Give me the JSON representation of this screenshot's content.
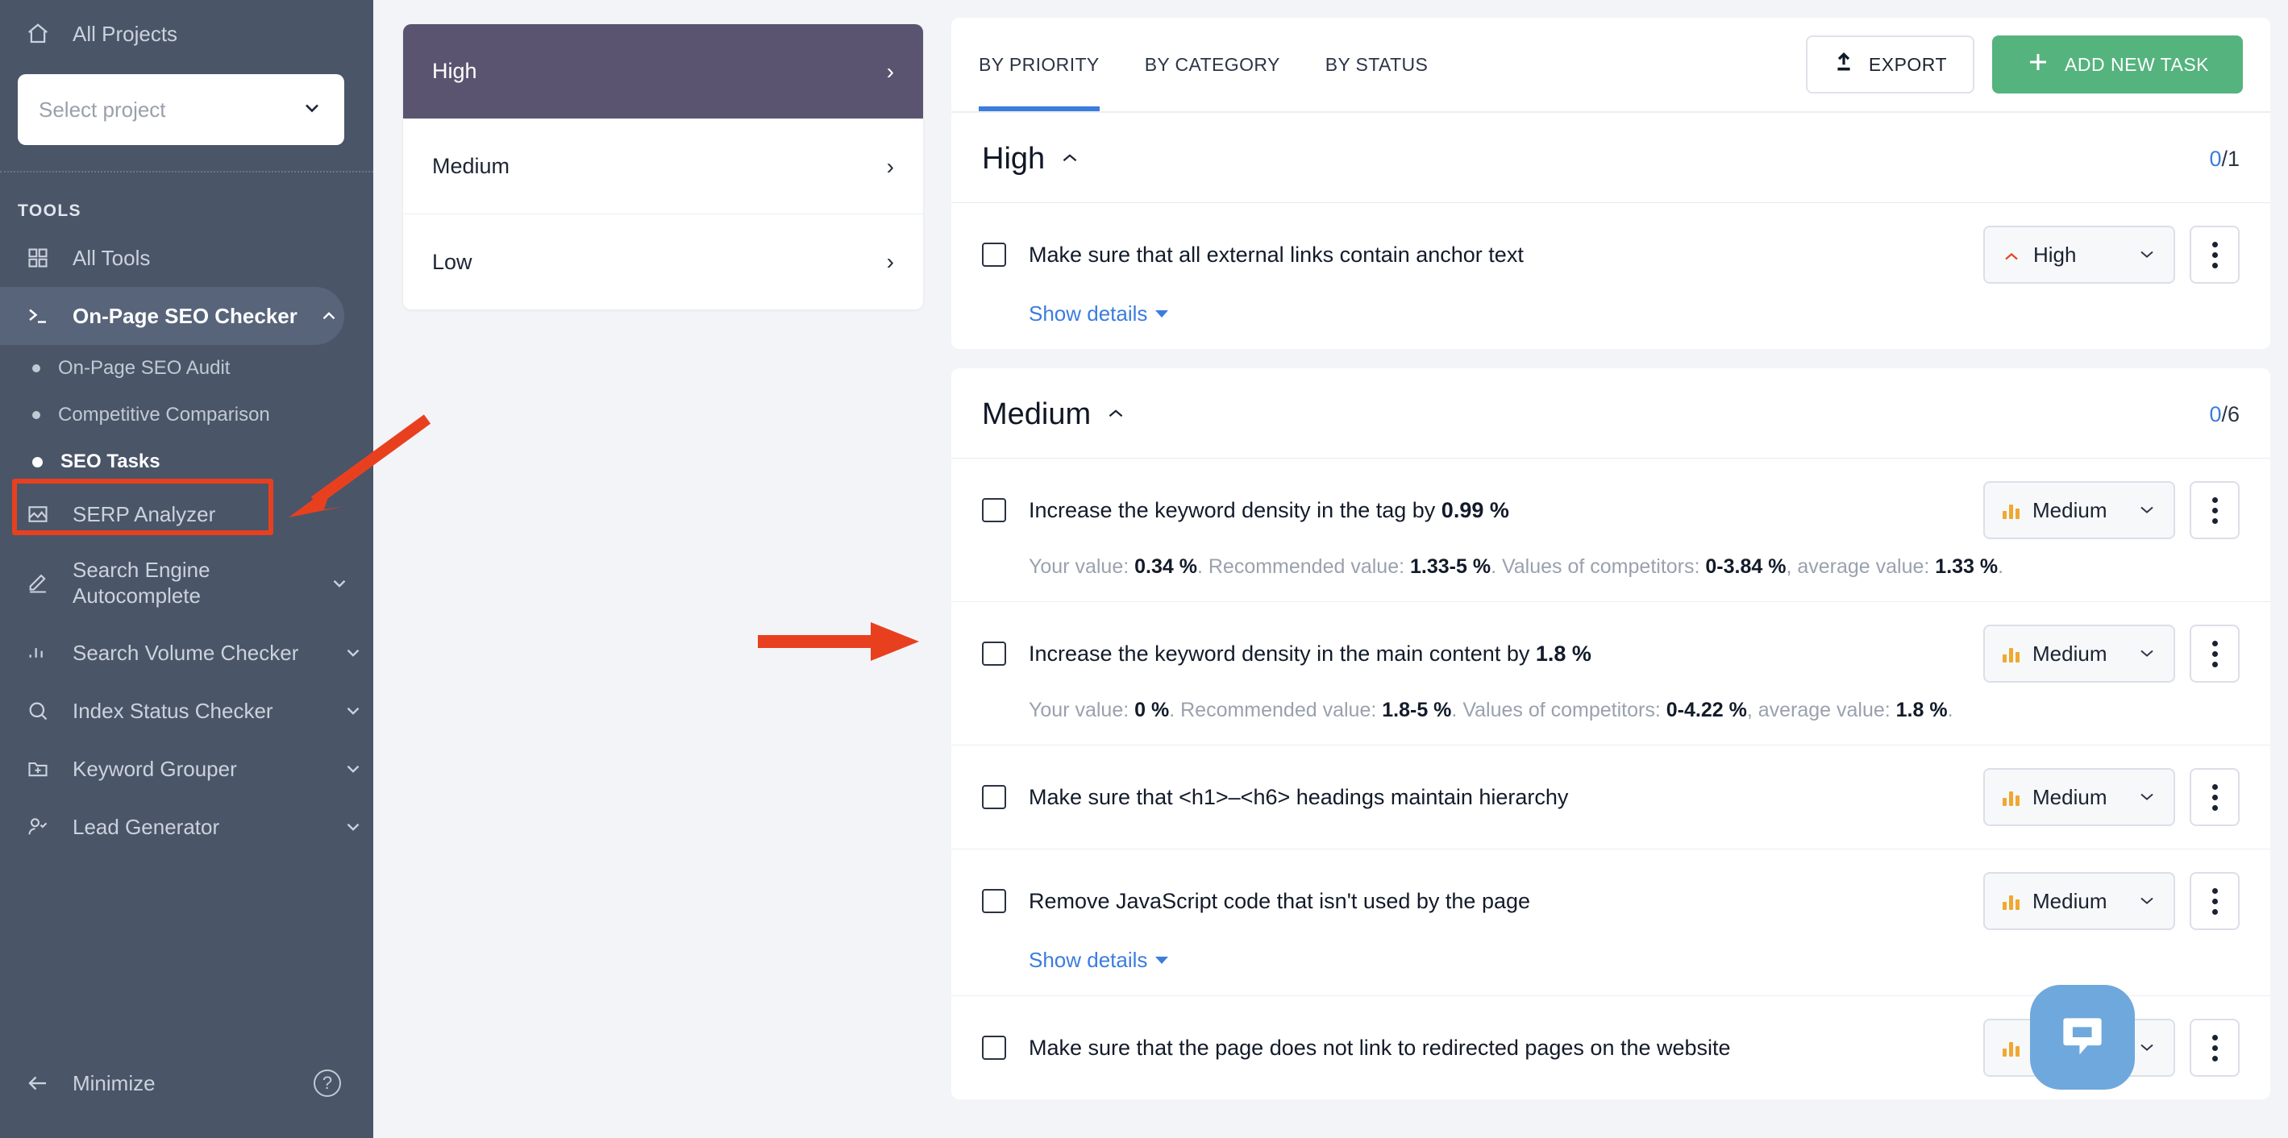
{
  "sidebar": {
    "all_projects": {
      "label": "All Projects",
      "icon": "home-icon"
    },
    "project_select": {
      "placeholder": "Select project",
      "icon": "chevron-down-icon"
    },
    "section_title": "TOOLS",
    "items": [
      {
        "label": "All Tools",
        "icon": "grid-icon",
        "caret": ""
      },
      {
        "label": "On-Page SEO Checker",
        "icon": "terminal-icon",
        "caret": "˄",
        "active": true
      },
      {
        "label": "SERP Analyzer",
        "icon": "image-chart-icon",
        "caret": ""
      },
      {
        "label": "Search Engine Autocomplete",
        "icon": "pencil-icon",
        "caret": "˅"
      },
      {
        "label": "Search Volume Checker",
        "icon": "bar-chart-icon",
        "caret": "˅"
      },
      {
        "label": "Index Status Checker",
        "icon": "search-icon",
        "caret": "˅"
      },
      {
        "label": "Keyword Grouper",
        "icon": "folder-plus-icon",
        "caret": "˅"
      },
      {
        "label": "Lead Generator",
        "icon": "user-check-icon",
        "caret": "˅"
      }
    ],
    "subitems": [
      {
        "label": "On-Page SEO Audit",
        "selected": false
      },
      {
        "label": "Competitive Comparison",
        "selected": false
      },
      {
        "label": "SEO Tasks",
        "selected": true
      }
    ],
    "minimize": {
      "label": "Minimize",
      "icon": "arrow-left-icon"
    },
    "help": "?"
  },
  "priority_panel": {
    "items": [
      {
        "label": "High",
        "chevron": "›",
        "active": true
      },
      {
        "label": "Medium",
        "chevron": "›",
        "active": false
      },
      {
        "label": "Low",
        "chevron": "›",
        "active": false
      }
    ]
  },
  "toolbar": {
    "tabs": [
      {
        "label": "BY PRIORITY",
        "active": true
      },
      {
        "label": "BY CATEGORY",
        "active": false
      },
      {
        "label": "BY STATUS",
        "active": false
      }
    ],
    "export_label": "EXPORT",
    "add_task_label": "ADD NEW TASK",
    "accent_green": "#55b37e",
    "accent_blue": "#3b7ddd"
  },
  "sections": {
    "high": {
      "title": "High",
      "caret": "˄",
      "count_done": "0",
      "count_total": "/1",
      "tasks": [
        {
          "text": "Make sure that all external links contain anchor text",
          "priority": "High",
          "priority_icon": "chevron-up-icon",
          "show_details": "Show details",
          "detail": null
        }
      ]
    },
    "medium": {
      "title": "Medium",
      "caret": "˄",
      "count_done": "0",
      "count_total": "/6",
      "tasks": [
        {
          "text_plain": "Increase the keyword density in the tag by ",
          "text_bold": "0.99 %",
          "priority": "Medium",
          "priority_icon": "bar-chart-icon",
          "detail": {
            "your_value_label": "Your value: ",
            "your_value": "0.34 %",
            "recommended_label": ". Recommended value: ",
            "recommended_value": "1.33-5 %",
            "competitors_label": ". Values of competitors: ",
            "competitors_value": "0-3.84 %",
            "average_label": ", average value: ",
            "average_value": "1.33 %",
            "end": "."
          }
        },
        {
          "text_plain": "Increase the keyword density in the main content by ",
          "text_bold": "1.8 %",
          "priority": "Medium",
          "priority_icon": "bar-chart-icon",
          "detail": {
            "your_value_label": "Your value: ",
            "your_value": "0 %",
            "recommended_label": ". Recommended value: ",
            "recommended_value": "1.8-5 %",
            "competitors_label": ". Values of competitors: ",
            "competitors_value": "0-4.22 %",
            "average_label": ", average value: ",
            "average_value": "1.8 %",
            "end": "."
          }
        },
        {
          "text_plain": "Make sure that <h1>–<h6> headings maintain hierarchy",
          "text_bold": "",
          "priority": "Medium",
          "priority_icon": "bar-chart-icon",
          "detail": null
        },
        {
          "text_plain": "Remove JavaScript code that isn't used by the page",
          "text_bold": "",
          "priority": "Medium",
          "priority_icon": "bar-chart-icon",
          "show_details": "Show details",
          "detail": null
        },
        {
          "text_plain": "Make sure that the page does not link to redirected pages on the website",
          "text_bold": "",
          "priority": "Medium",
          "priority_icon": "bar-chart-icon",
          "detail": null
        }
      ]
    }
  },
  "annotations": {
    "highlight_color": "#e8401f",
    "box_target": "SEO Tasks",
    "arrow_count": 2
  },
  "chat_widget": {
    "icon": "chat-bubble-icon",
    "color": "#6fa8dc"
  }
}
